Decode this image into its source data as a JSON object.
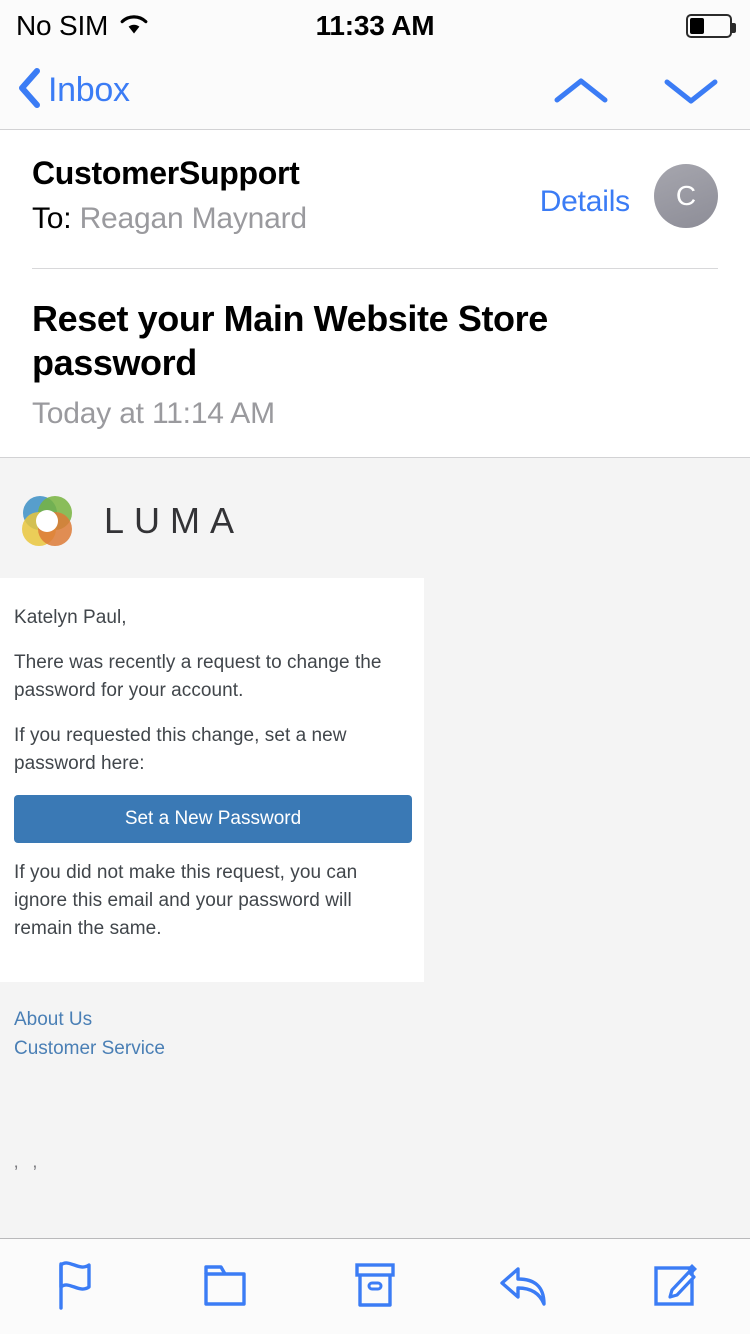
{
  "status_bar": {
    "carrier": "No SIM",
    "wifi_icon": "wifi-icon",
    "time": "11:33 AM",
    "battery_icon": "battery-icon",
    "battery_level_percent": 34
  },
  "nav_bar": {
    "back_label": "Inbox",
    "back_icon": "chevron-left-icon",
    "previous_message_icon": "chevron-up-icon",
    "next_message_icon": "chevron-down-icon",
    "tint_color": "#3b7cf5"
  },
  "message_header": {
    "sender": "CustomerSupport",
    "to_label": "To:",
    "recipient": "Reagan Maynard",
    "details_label": "Details",
    "avatar_initial": "C"
  },
  "subject_block": {
    "subject": "Reset your Main Website Store password",
    "date": "Today at 11:14 AM"
  },
  "email_body": {
    "brand": {
      "logo_icon": "luma-rings-logo",
      "wordmark": "LUMA",
      "colors": {
        "blue": "#3e95cf",
        "green": "#7dbc42",
        "yellow": "#f4d03f",
        "orange": "#e8803a"
      }
    },
    "greeting": "Katelyn Paul,",
    "paragraph_1": "There was recently a request to change the password for your account.",
    "paragraph_2": "If you requested this change, set a new password here:",
    "cta_label": "Set a New Password",
    "cta_color": "#3a79b5",
    "paragraph_3": "If you did not make this request, you can ignore this email and your password will remain the same.",
    "footer_links": [
      {
        "label": "About Us"
      },
      {
        "label": "Customer Service"
      }
    ],
    "stray_text": "’ ’"
  },
  "toolbar": {
    "items": [
      {
        "name": "flag-icon",
        "label": "Flag"
      },
      {
        "name": "folder-icon",
        "label": "Move to Folder"
      },
      {
        "name": "archive-icon",
        "label": "Archive"
      },
      {
        "name": "reply-icon",
        "label": "Reply"
      },
      {
        "name": "compose-icon",
        "label": "Compose"
      }
    ],
    "tint_color": "#3b7cf5"
  }
}
